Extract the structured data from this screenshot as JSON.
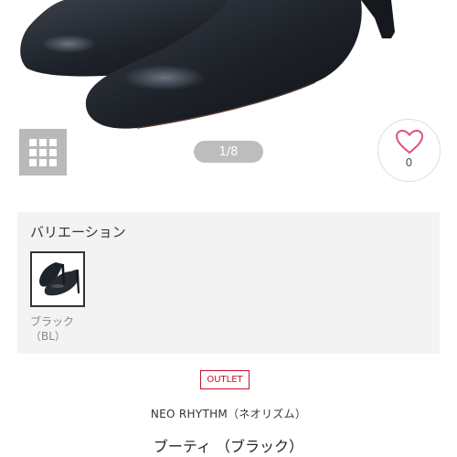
{
  "gallery": {
    "counter": "1/8",
    "like_count": "0"
  },
  "icons": {
    "grid": "grid-view-icon",
    "heart": "heart-outline-icon"
  },
  "variation": {
    "title": "バリエーション",
    "options": [
      {
        "color_label": "ブラック",
        "code_label": "（BL）"
      }
    ]
  },
  "product": {
    "badge": "OUTLET",
    "brand": "NEO RHYTHM（ネオリズム）",
    "name": "ブーティ （ブラック）"
  },
  "colors": {
    "accent_red": "#c8102e",
    "heart_pink": "#e0507a",
    "shoe_black": "#1e2229"
  }
}
